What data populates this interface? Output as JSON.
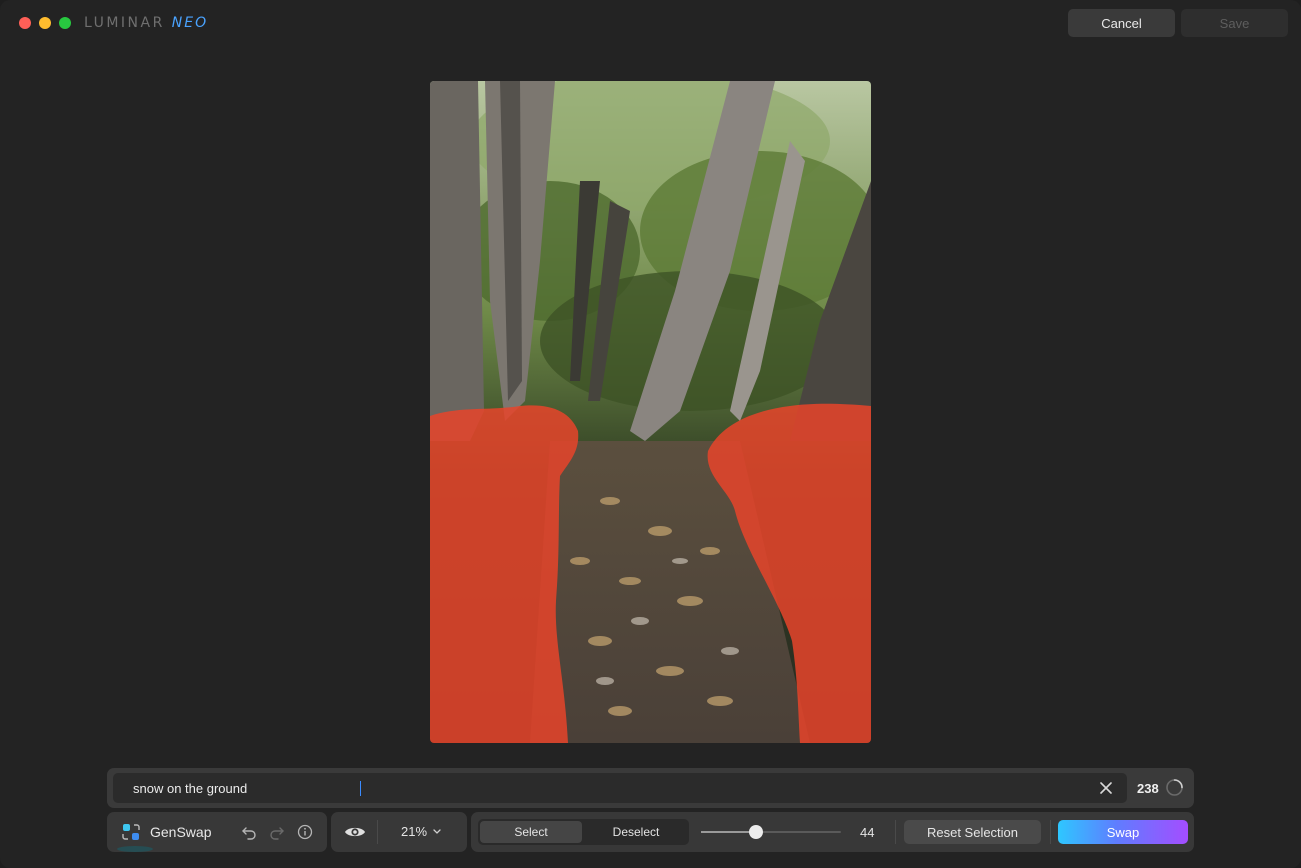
{
  "window": {
    "logo_main": "LUMINAR",
    "logo_accent": "NEO",
    "cancel_label": "Cancel",
    "save_label": "Save"
  },
  "prompt": {
    "value": "snow on the ground",
    "credits": "238"
  },
  "toolbar": {
    "tool_name": "GenSwap",
    "zoom": "21%",
    "select_label": "Select",
    "deselect_label": "Deselect",
    "brush_size": "44",
    "brush_size_fraction": 0.39,
    "reset_label": "Reset Selection",
    "swap_label": "Swap"
  },
  "colors": {
    "accent": "#3b8cff",
    "mask": "#e8442a",
    "swap_gradient_start": "#2ec7ff",
    "swap_gradient_end": "#a44dff"
  }
}
